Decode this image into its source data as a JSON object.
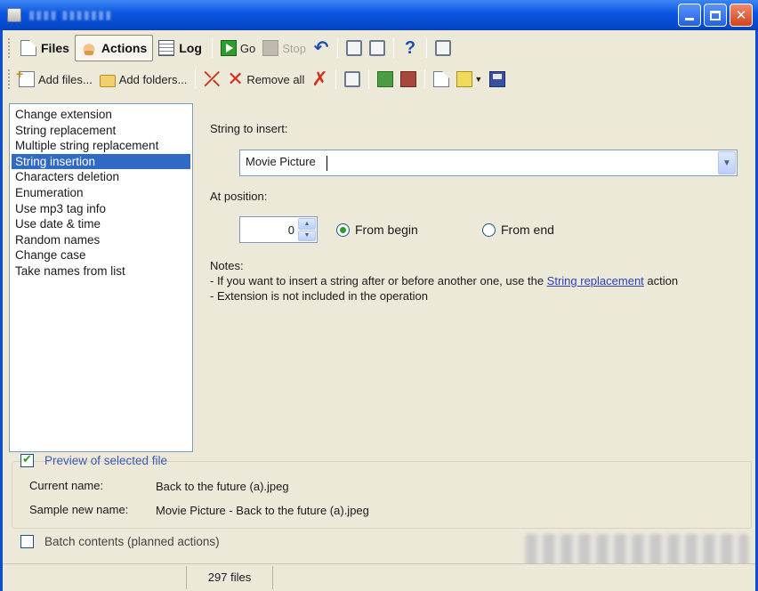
{
  "toolbar": {
    "tabs": [
      {
        "label": "Files",
        "icon": "files-icon"
      },
      {
        "label": "Actions",
        "icon": "actions-icon"
      },
      {
        "label": "Log",
        "icon": "log-icon"
      }
    ],
    "go_label": "Go",
    "stop_label": "Stop",
    "add_files_label": "Add files...",
    "add_folders_label": "Add folders...",
    "remove_all_label": "Remove all"
  },
  "actions": {
    "items": [
      "Change extension",
      "String replacement",
      "Multiple string replacement",
      "String insertion",
      "Characters deletion",
      "Enumeration",
      "Use mp3 tag info",
      "Use date & time",
      "Random names",
      "Change case",
      "Take names from list"
    ],
    "selected": "String insertion"
  },
  "insertion": {
    "string_label": "String to insert:",
    "string_value": "Movie Picture",
    "position_label": "At position:",
    "position_value": "0",
    "from_begin_label": "From begin",
    "from_end_label": "From end",
    "selected_option": "From begin"
  },
  "notes": {
    "title": "Notes:",
    "line1_before": "- If you want to insert a string after or before another one, use the ",
    "line1_link": "String replacement",
    "line1_after": " action",
    "line2": "- Extension is not included in the operation"
  },
  "preview": {
    "checkbox_label": "Preview of selected file",
    "checked": true,
    "current_name_label": "Current name:",
    "current_name_value": "Back to the future (a).jpeg",
    "sample_name_label": "Sample new name:",
    "sample_name_value": "Movie Picture - Back to the future (a).jpeg"
  },
  "batch": {
    "checkbox_label": "Batch contents (planned actions)",
    "checked": false
  },
  "status": {
    "file_count": "297 files"
  },
  "colors": {
    "titlebar": "#0a55e0",
    "selection": "#316ac5",
    "link": "#2b3fb8",
    "radio_on": "#2b9b2b"
  }
}
